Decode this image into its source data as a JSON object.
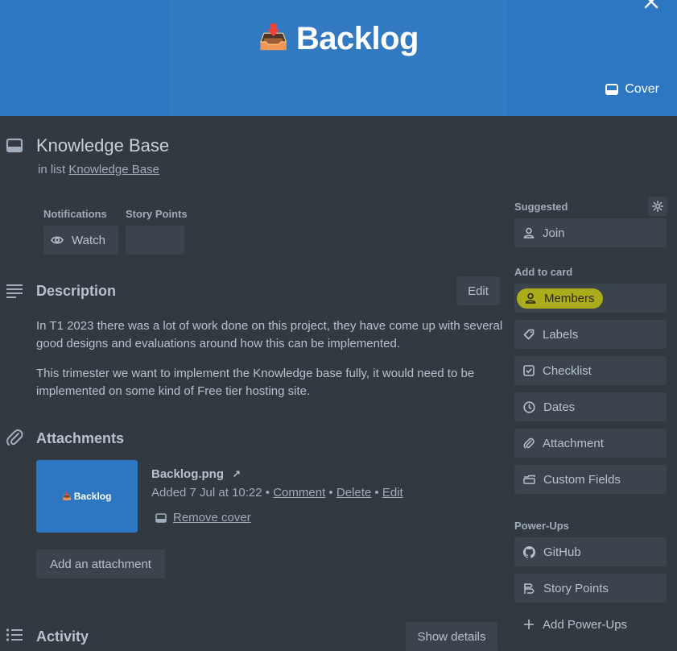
{
  "cover": {
    "emoji": "📥",
    "title": "Backlog",
    "cover_button_label": "Cover"
  },
  "card": {
    "title": "Knowledge Base",
    "in_list_prefix": "in list",
    "list_name": "Knowledge Base"
  },
  "fields": {
    "notifications_label": "Notifications",
    "watch_label": "Watch",
    "story_points_label": "Story Points",
    "story_points_value": ""
  },
  "description": {
    "title": "Description",
    "edit_label": "Edit",
    "paragraphs": [
      "In T1 2023 there was a lot of work done on this project, they have come up with several good designs and evaluations around how this can be implemented.",
      "This trimester we want to implement the Knowledge base fully, it would need to be implemented on some kind of Free tier hosting site."
    ]
  },
  "attachments": {
    "title": "Attachments",
    "thumb_emoji": "📥",
    "thumb_text": "Backlog",
    "file_name": "Backlog.png",
    "open_glyph": "↗",
    "added_text": "Added 7 Jul at 10:22",
    "sep": "•",
    "comment_label": "Comment",
    "delete_label": "Delete",
    "edit_label": "Edit",
    "remove_cover_label": "Remove cover",
    "add_label": "Add an attachment"
  },
  "activity": {
    "title": "Activity",
    "show_details_label": "Show details"
  },
  "sidebar": {
    "suggested_label": "Suggested",
    "join_label": "Join",
    "add_to_card_label": "Add to card",
    "add_items": [
      {
        "label": "Members",
        "icon": "person-icon"
      },
      {
        "label": "Labels",
        "icon": "tag-icon"
      },
      {
        "label": "Checklist",
        "icon": "checkbox-icon"
      },
      {
        "label": "Dates",
        "icon": "clock-icon"
      },
      {
        "label": "Attachment",
        "icon": "paperclip-icon"
      },
      {
        "label": "Custom Fields",
        "icon": "custom-fields-icon"
      }
    ],
    "powerups_label": "Power-Ups",
    "github_label": "GitHub",
    "story_points_label": "Story Points",
    "add_powerups_label": "Add Power-Ups"
  },
  "colors": {
    "cover_blue": "#2d77c2",
    "panel_bg": "#323940",
    "button_bg": "#3b444c",
    "highlight": "#bebe14"
  }
}
